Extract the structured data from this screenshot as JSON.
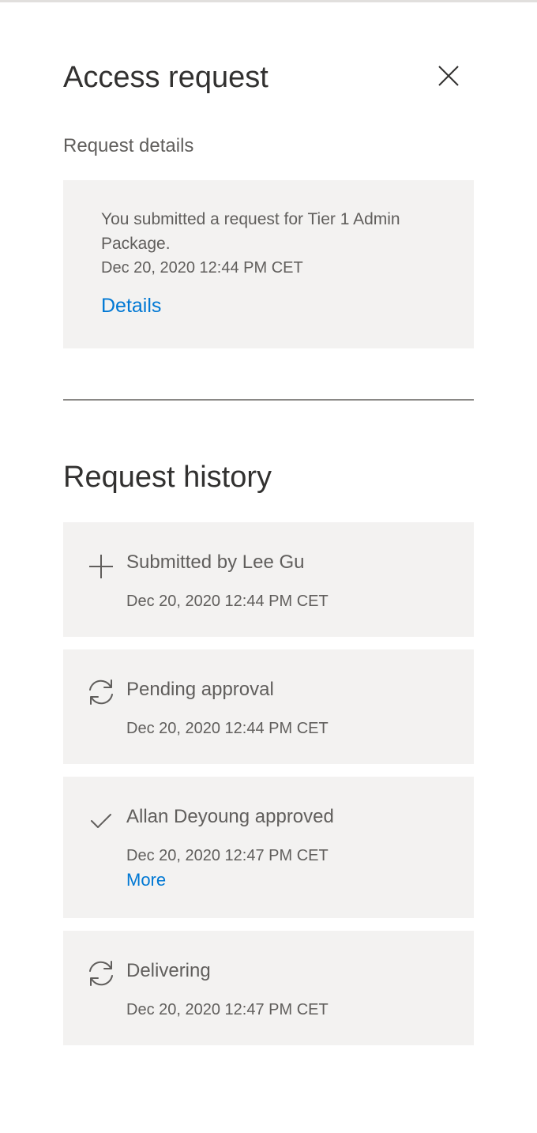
{
  "panel": {
    "title": "Access request",
    "close_icon": "close-icon"
  },
  "request_details": {
    "section_label": "Request details",
    "message": "You submitted a request for Tier 1 Admin Package.",
    "date": "Dec 20, 2020 12:44 PM CET",
    "details_link": "Details"
  },
  "request_history": {
    "title": "Request history",
    "items": [
      {
        "icon": "add-icon",
        "label": "Submitted by Lee Gu",
        "date": "Dec 20, 2020 12:44 PM CET"
      },
      {
        "icon": "refresh-icon",
        "label": "Pending approval",
        "date": "Dec 20, 2020 12:44 PM CET"
      },
      {
        "icon": "checkmark-icon",
        "label": "Allan Deyoung approved",
        "date": "Dec 20, 2020 12:47 PM CET",
        "more_link": "More"
      },
      {
        "icon": "refresh-icon",
        "label": "Delivering",
        "date": "Dec 20, 2020 12:47 PM CET"
      }
    ]
  },
  "colors": {
    "accent": "#0078d4",
    "card_background": "#f3f2f1",
    "text": "#605e5c",
    "title_text": "#323130"
  }
}
